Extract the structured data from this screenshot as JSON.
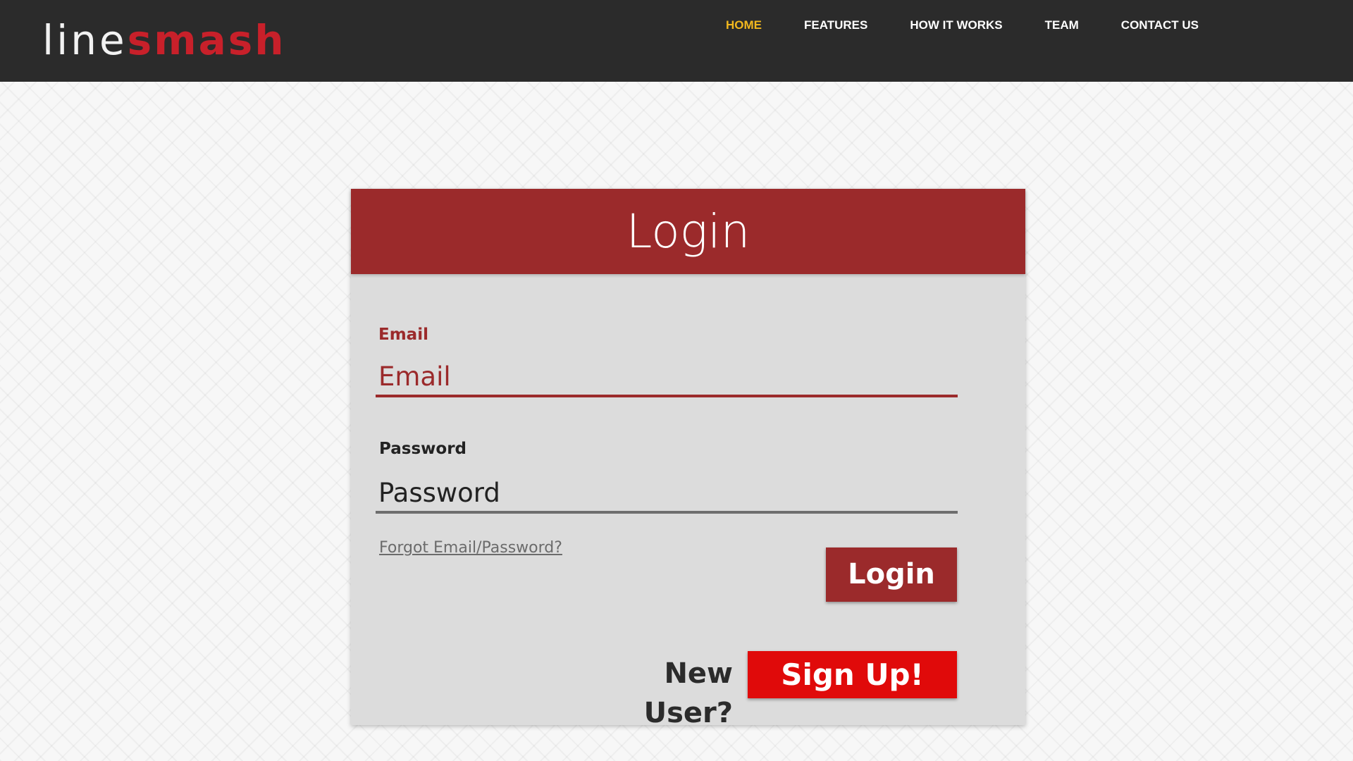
{
  "header": {
    "logo_part1": "line",
    "logo_part2": "smash",
    "nav": [
      {
        "label": "HOME",
        "active": true
      },
      {
        "label": "FEATURES",
        "active": false
      },
      {
        "label": "HOW IT WORKS",
        "active": false
      },
      {
        "label": "TEAM",
        "active": false
      },
      {
        "label": "CONTACT US",
        "active": false
      }
    ]
  },
  "login": {
    "title": "Login",
    "email_label": "Email",
    "email_placeholder": "Email",
    "password_label": "Password",
    "password_placeholder": "Password",
    "forgot_link": "Forgot Email/Password?",
    "login_button": "Login",
    "new_user_text": "New User?",
    "signup_button": "Sign Up!"
  },
  "colors": {
    "navbar_bg": "#2b2b2b",
    "brand_red": "#9b2a2b",
    "logo_red": "#c8202a",
    "signup_red": "#e00a0a",
    "nav_active": "#f2b81e",
    "card_bg": "#dcdcdc"
  }
}
